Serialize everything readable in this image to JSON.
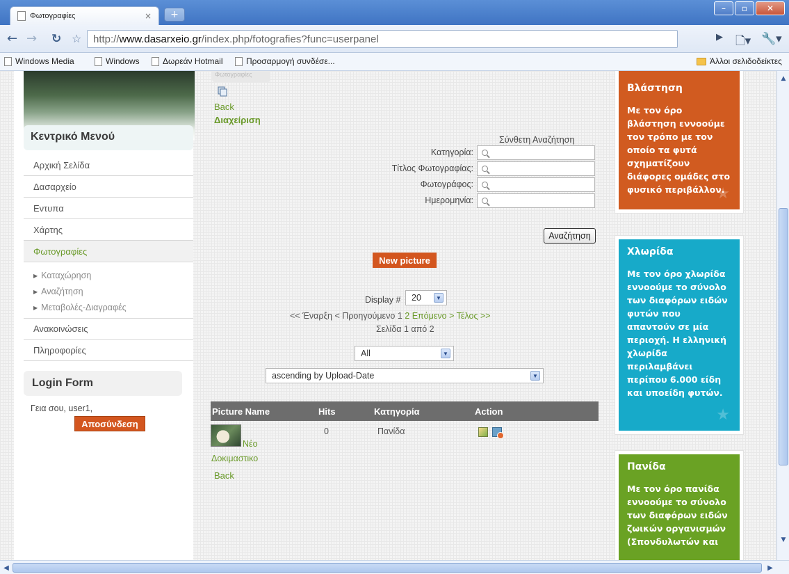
{
  "browser": {
    "tab_title": "Φωτογραφίες",
    "tab_close": "×",
    "new_tab": "+",
    "url_prefix": "http://",
    "url_domain": "www.dasarxeio.gr",
    "url_path": "/index.php/fotografies?func=userpanel",
    "bookmarks": [
      "Windows Media",
      "Windows",
      "Δωρεάν Hotmail",
      "Προσαρμογή συνδέσε..."
    ],
    "other_bookmarks": "Άλλοι σελιδοδείκτες"
  },
  "sidebar": {
    "menu_title": "Κεντρικό Μενού",
    "items": [
      "Αρχική Σελίδα",
      "Δασαρχείο",
      "Εντυπα",
      "Χάρτης",
      "Φωτογραφίες"
    ],
    "sub_items": [
      "Καταχώρηση",
      "Αναζήτηση",
      "Μεταβολές-Διαγραφές"
    ],
    "items_after": [
      "Ανακοινώσεις",
      "Πληροφορίες"
    ],
    "login_title": "Login Form",
    "greeting": "Γεια σου, user1,",
    "logout_label": "Αποσύνδεση"
  },
  "main": {
    "breadcrumb": "Φωτογραφίες",
    "back_label": "Back",
    "manage_label": "Διαχείριση",
    "advanced_search": "Σύνθετη Αναζήτηση",
    "fields": [
      "Κατηγορία:",
      "Τίτλος Φωτογραφίας:",
      "Φωτογράφος:",
      "Ημερομηνία:"
    ],
    "search_button": "Αναζήτηση",
    "new_picture": "New picture",
    "display_label": "Display #",
    "display_value": "20",
    "pager": {
      "start": "<< Έναρξη",
      "prev": "< Προηγούμενο",
      "page1": "1",
      "page2": "2",
      "next": "Επόμενο >",
      "end": "Τέλος >>"
    },
    "page_info": "Σελίδα 1 από 2",
    "filter_value": "All",
    "sort_value": "ascending by Upload-Date",
    "table": {
      "headers": [
        "Picture Name",
        "Hits",
        "Κατηγορία",
        "Action"
      ],
      "rows": [
        {
          "name_line1": "Νέο",
          "name_line2": "Δοκιμαστικο",
          "hits": "0",
          "category": "Πανίδα"
        }
      ]
    },
    "back_bottom": "Back"
  },
  "right_boxes": [
    {
      "title": "Βλάστηση",
      "text": "Με τον όρο βλάστηση εννοούμε τον τρόπο με τον οποίο τα φυτά σχηματίζουν διάφορες ομάδες στο φυσικό περιβάλλον.",
      "color": "#d15b20"
    },
    {
      "title": "Χλωρίδα",
      "text": "Με τον όρο χλωρίδα εννοούμε το σύνολο των διαφόρων ειδών φυτών που απαντούν σε μία περιοχή. Η ελληνική χλωρίδα περιλαμβάνει περίπου 6.000 είδη και υποείδη φυτών.",
      "color": "#17aac9"
    },
    {
      "title": "Πανίδα",
      "text": "Με τον όρο πανίδα εννοούμε το σύνολο των διαφόρων ειδών ζωικών οργανισμών (Σπονδυλωτών και",
      "color": "#6aa224"
    }
  ]
}
